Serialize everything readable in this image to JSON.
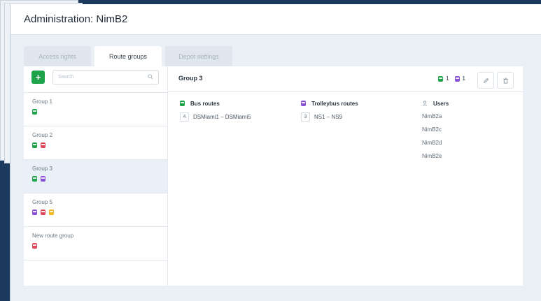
{
  "window": {
    "title": "Administration: NimB2"
  },
  "tabs": [
    {
      "label": "Access rights",
      "active": false
    },
    {
      "label": "Route groups",
      "active": true
    },
    {
      "label": "Depot settings",
      "active": false
    }
  ],
  "sidebar": {
    "add_label": "+",
    "search_placeholder": "Search",
    "groups": [
      {
        "name": "Group 1",
        "icons": [
          "bus-icon"
        ]
      },
      {
        "name": "Group 2",
        "icons": [
          "bus-icon",
          "tram-icon"
        ]
      },
      {
        "name": "Group 3",
        "icons": [
          "bus-icon",
          "trolleybus-icon"
        ],
        "selected": true
      },
      {
        "name": "Group 5",
        "icons": [
          "trolleybus-icon",
          "tram-icon",
          "minibus-icon"
        ]
      },
      {
        "name": "New route group",
        "icons": [
          "tram-icon"
        ]
      }
    ]
  },
  "detail": {
    "title": "Group 3",
    "bus_count": "1",
    "trolleybus_count": "1",
    "columns": {
      "bus": {
        "heading": "Bus routes",
        "count": "4",
        "range": "DSMiami1 – DSMiami5"
      },
      "trolleybus": {
        "heading": "Trolleybus routes",
        "count": "3",
        "range": "NS1 – NS9"
      },
      "users": {
        "heading": "Users",
        "items": [
          "NimB2a",
          "NimB2c",
          "NimB2d",
          "NimB2e"
        ]
      }
    }
  },
  "colors": {
    "bus": "#1fa34a",
    "trolleybus": "#8a52d6",
    "tram": "#e0475b",
    "minibus": "#f2b51d",
    "background": "#1b3a5e"
  }
}
